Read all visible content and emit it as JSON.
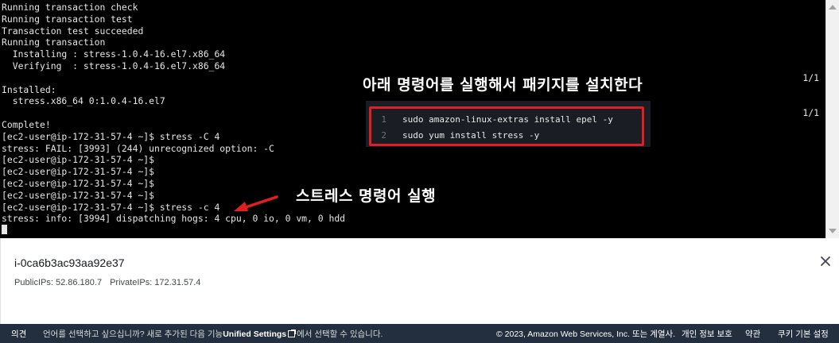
{
  "terminal": {
    "lines": [
      "Running transaction check",
      "Running transaction test",
      "Transaction test succeeded",
      "Running transaction",
      "  Installing : stress-1.0.4-16.el7.x86_64",
      "  Verifying  : stress-1.0.4-16.el7.x86_64",
      "",
      "Installed:",
      "  stress.x86_64 0:1.0.4-16.el7",
      "",
      "Complete!",
      "[ec2-user@ip-172-31-57-4 ~]$ stress -C 4",
      "stress: FAIL: [3993] (244) unrecognized option: -C",
      "[ec2-user@ip-172-31-57-4 ~]$",
      "[ec2-user@ip-172-31-57-4 ~]$",
      "[ec2-user@ip-172-31-57-4 ~]$",
      "[ec2-user@ip-172-31-57-4 ~]$",
      "[ec2-user@ip-172-31-57-4 ~]$ stress -c 4",
      "stress: info: [3994] dispatching hogs: 4 cpu, 0 io, 0 vm, 0 hdd"
    ],
    "progress": [
      "1/1",
      "1/1"
    ]
  },
  "annotation": {
    "install_title": "아래 명령어를 실행해서 패키지를 설치한다",
    "code": [
      {
        "num": "1",
        "text": "sudo amazon-linux-extras install epel -y"
      },
      {
        "num": "2",
        "text": "sudo yum install stress -y"
      }
    ],
    "stress_label": "스트레스 명령어 실행"
  },
  "instance": {
    "id": "i-0ca6b3ac93aa92e37",
    "public_ips": "PublicIPs: 52.86.180.7",
    "private_ips": "PrivateIPs: 172.31.57.4"
  },
  "footer": {
    "feedback": "의견",
    "language_prompt": "언어를 선택하고 싶으십니까? 새로 추가된 다음 기능",
    "unified_settings": "Unified Settings",
    "language_suffix": "에서 선택할 수 있습니다.",
    "copyright": "© 2023, Amazon Web Services, Inc. 또는 계열사.",
    "privacy": "개인 정보 보호",
    "terms": "약관",
    "cookie": "쿠키 기본 설정"
  },
  "colors": {
    "terminal_bg": "#000000",
    "highlight_box": "#e02020",
    "footer_bg": "#232f3e"
  }
}
